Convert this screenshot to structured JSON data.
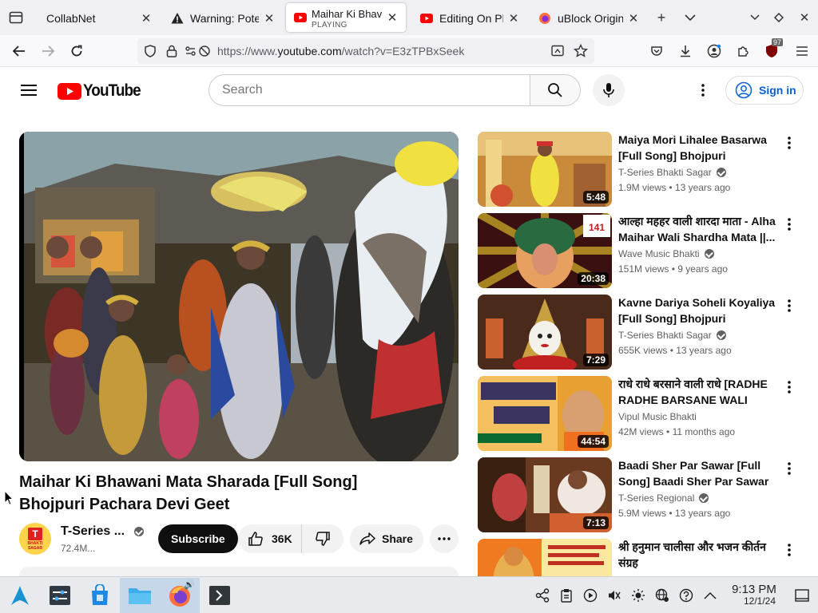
{
  "browser": {
    "tabs": [
      {
        "title": "CollabNet",
        "icon": "none"
      },
      {
        "title": "Warning: Poter",
        "icon": "warning-icon"
      },
      {
        "title": "Maihar Ki Bhav",
        "subtitle": "PLAYING",
        "icon": "youtube-icon",
        "active": true
      },
      {
        "title": "Editing On Pho",
        "icon": "youtube-icon"
      },
      {
        "title": "uBlock Origin -",
        "icon": "firefox-icon"
      }
    ],
    "url_prefix": "https://www.",
    "url_domain": "youtube.com",
    "url_path": "/watch?v=E3zTPBxSeek",
    "ublock_badge": "97"
  },
  "youtube": {
    "logo_text": "YouTube",
    "search_placeholder": "Search",
    "sign_in": "Sign in",
    "brand_color": "#ff0000"
  },
  "video": {
    "title": "Maihar Ki Bhawani Mata Sharada [Full Song] Bhojpuri Pachara Devi Geet",
    "channel": "T-Series ...",
    "subscribers": "72.4M...",
    "subscribe_label": "Subscribe",
    "likes": "36K",
    "share_label": "Share",
    "avatar_text": "BHAKTI SAGAR"
  },
  "recommendations": [
    {
      "title": "Maiya Mori Lihalee Basarwa [Full Song] Bhojpuri Pachara...",
      "channel": "T-Series Bhakti Sagar",
      "verified": true,
      "views": "1.9M views",
      "age": "13 years ago",
      "duration": "5:48"
    },
    {
      "title": "आल्हा महहर वाली शारदा माता - Alha Maihar Wali Shardha Mata ||...",
      "channel": "Wave Music Bhakti",
      "verified": true,
      "views": "151M views",
      "age": "9 years ago",
      "duration": "20:38"
    },
    {
      "title": "Kavne Dariya Soheli Koyaliya [Full Song] Bhojpuri Pachara...",
      "channel": "T-Series Bhakti Sagar",
      "verified": true,
      "views": "655K views",
      "age": "13 years ago",
      "duration": "7:29"
    },
    {
      "title": "राधे राधे बरसाने वाली राधे [RADHE RADHE BARSANE WALI RADH...",
      "channel": "Vipul Music Bhakti",
      "verified": false,
      "views": "42M views",
      "age": "11 months ago",
      "duration": "44:54"
    },
    {
      "title": "Baadi Sher Par Sawar [Full Song] Baadi Sher Par Sawar",
      "channel": "T-Series Regional",
      "verified": true,
      "views": "5.9M views",
      "age": "13 years ago",
      "duration": "7:13"
    },
    {
      "title": "श्री हनुमान चालीसा और भजन कीर्तन संग्रह",
      "channel": "",
      "verified": false,
      "views": "",
      "age": "",
      "duration": ""
    }
  ],
  "taskbar": {
    "time": "9:13 PM",
    "date": "12/1/24"
  }
}
